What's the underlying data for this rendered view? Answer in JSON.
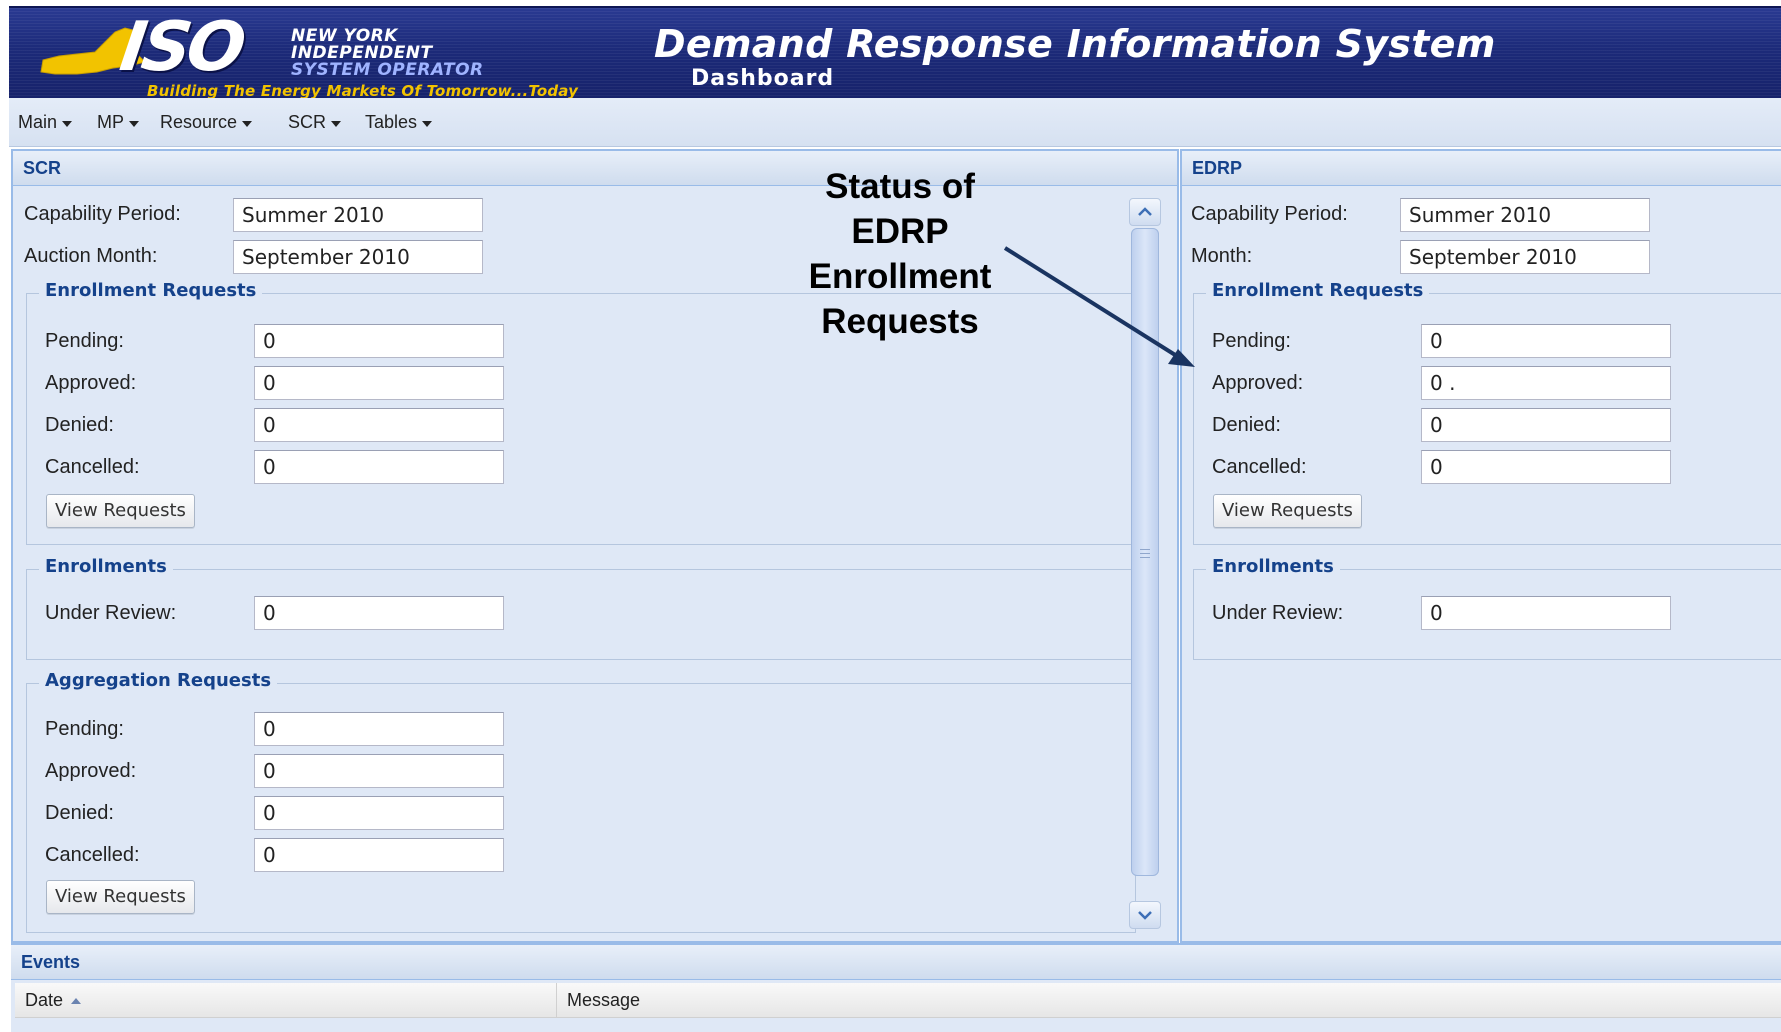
{
  "header": {
    "logo_iso": "ISO",
    "logo_line1": "NEW YORK",
    "logo_line2": "INDEPENDENT",
    "logo_line3": "SYSTEM OPERATOR",
    "tagline": "Building The Energy Markets Of Tomorrow...Today",
    "app_title": "Demand Response Information System",
    "page_title": "Dashboard"
  },
  "menu": [
    {
      "label": "Main"
    },
    {
      "label": "MP"
    },
    {
      "label": "Resource"
    },
    {
      "label": "SCR"
    },
    {
      "label": "Tables"
    }
  ],
  "scr": {
    "title": "SCR",
    "capability_period_label": "Capability Period:",
    "capability_period_value": "Summer 2010",
    "auction_month_label": "Auction Month:",
    "auction_month_value": "September 2010",
    "enrollment_requests": {
      "legend": "Enrollment Requests",
      "pending_label": "Pending:",
      "pending_value": "0",
      "approved_label": "Approved:",
      "approved_value": "0",
      "denied_label": "Denied:",
      "denied_value": "0",
      "cancelled_label": "Cancelled:",
      "cancelled_value": "0",
      "button": "View Requests"
    },
    "enrollments": {
      "legend": "Enrollments",
      "under_review_label": "Under Review:",
      "under_review_value": "0"
    },
    "aggregation_requests": {
      "legend": "Aggregation Requests",
      "pending_label": "Pending:",
      "pending_value": "0",
      "approved_label": "Approved:",
      "approved_value": "0",
      "denied_label": "Denied:",
      "denied_value": "0",
      "cancelled_label": "Cancelled:",
      "cancelled_value": "0",
      "button": "View Requests"
    }
  },
  "edrp": {
    "title": "EDRP",
    "capability_period_label": "Capability Period:",
    "capability_period_value": "Summer 2010",
    "month_label": "Month:",
    "month_value": "September 2010",
    "enrollment_requests": {
      "legend": "Enrollment Requests",
      "pending_label": "Pending:",
      "pending_value": "0",
      "approved_label": "Approved:",
      "approved_value": "0 .",
      "denied_label": "Denied:",
      "denied_value": "0",
      "cancelled_label": "Cancelled:",
      "cancelled_value": "0",
      "button": "View Requests"
    },
    "enrollments": {
      "legend": "Enrollments",
      "under_review_label": "Under Review:",
      "under_review_value": "0"
    }
  },
  "events": {
    "title": "Events",
    "columns": [
      "Date",
      "Message"
    ]
  },
  "annotation": {
    "line1": "Status of",
    "line2": "EDRP",
    "line3": "Enrollment",
    "line4": "Requests"
  },
  "colors": {
    "banner": "#1c2a79",
    "panel_bg": "#dfe8f6",
    "panel_border": "#99bbe8",
    "header_text": "#15428b",
    "tagline": "#f2c300",
    "arrow": "#1a3461"
  }
}
